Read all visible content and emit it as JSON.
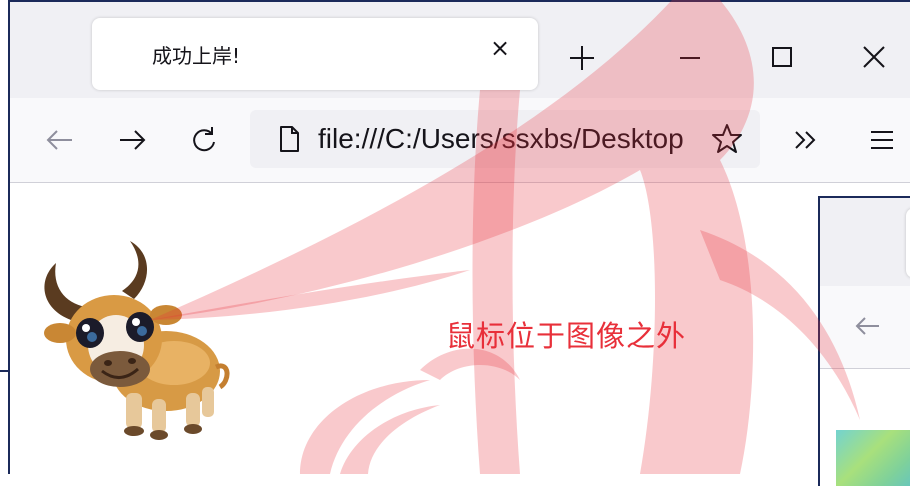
{
  "tab": {
    "title": "成功上岸!",
    "close_glyph": "×"
  },
  "urlbar": {
    "url": "file:///C:/Users/ssxbs/Desktop"
  },
  "page": {
    "hover_status": "鼠标位于图像之外"
  },
  "icons": {
    "new_tab": "plus-icon",
    "minimize": "minimize-icon",
    "maximize": "maximize-icon",
    "close_window": "close-icon",
    "back": "arrow-left-icon",
    "forward": "arrow-right-icon",
    "reload": "reload-icon",
    "page": "document-icon",
    "bookmark": "star-icon",
    "overflow": "chevron-double-right-icon",
    "menu": "hamburger-icon"
  },
  "colors": {
    "status_text": "#e8303a",
    "window_border": "#1b2a5a",
    "watermark": "#e8303a"
  }
}
